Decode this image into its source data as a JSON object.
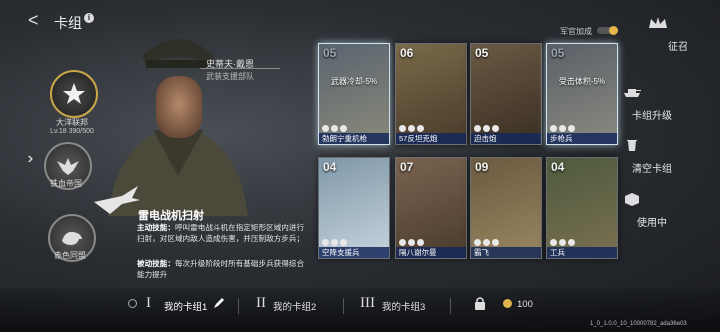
{
  "header": {
    "back": "<",
    "title": "卡组"
  },
  "factions": [
    {
      "name": "大洋联邦",
      "level": "Lv.18 390/500"
    },
    {
      "name": "铁血帝国"
    },
    {
      "name": "赤色同盟"
    }
  ],
  "commander": {
    "name": "史蒂夫·戴恩",
    "unit": "武装支援部队",
    "skill_name": "雷电战机扫射",
    "active_label": "主动技能：",
    "active_text": "呼叫雷电战斗机在指定矩形区域内进行扫射，对区域内敌人造成伤害，并压制敌方步兵；",
    "passive_label": "被动技能：",
    "passive_text": "每次升级阶段时所有基础步兵获得综合能力提升"
  },
  "officer_bonus": "军官加成",
  "cards": [
    {
      "cost": "05",
      "bonus": "武器冷却-5%",
      "name": "勃朗宁重机枪",
      "frost": true,
      "faded": true
    },
    {
      "cost": "06",
      "bonus": "",
      "name": "57反坦克炮",
      "frost": false,
      "faded": false
    },
    {
      "cost": "05",
      "bonus": "",
      "name": "迫击炮",
      "frost": false,
      "faded": false
    },
    {
      "cost": "05",
      "bonus": "受击体积-5%",
      "name": "步枪兵",
      "frost": true,
      "faded": true
    },
    {
      "cost": "04",
      "bonus": "",
      "name": "空降支援兵",
      "frost": false,
      "faded": false
    },
    {
      "cost": "07",
      "bonus": "",
      "name": "隔八谢尔曼",
      "frost": false,
      "faded": false
    },
    {
      "cost": "09",
      "bonus": "",
      "name": "霸飞",
      "frost": false,
      "faded": false
    },
    {
      "cost": "04",
      "bonus": "",
      "name": "工兵",
      "frost": false,
      "faded": false
    }
  ],
  "right_menu": {
    "recruit": "征召",
    "upgrade": "卡组升级",
    "clear": "清空卡组",
    "in_use": "使用中"
  },
  "decks": [
    {
      "roman": "I",
      "label": "我的卡组1"
    },
    {
      "roman": "II",
      "label": "我的卡组2"
    },
    {
      "roman": "III",
      "label": "我的卡组3"
    }
  ],
  "currency": "100",
  "version": "1_0_1.0.0_10_10000782_ada36e03",
  "colors": {
    "gold": "#c9a64a",
    "card_name_bg": "#14285a"
  }
}
